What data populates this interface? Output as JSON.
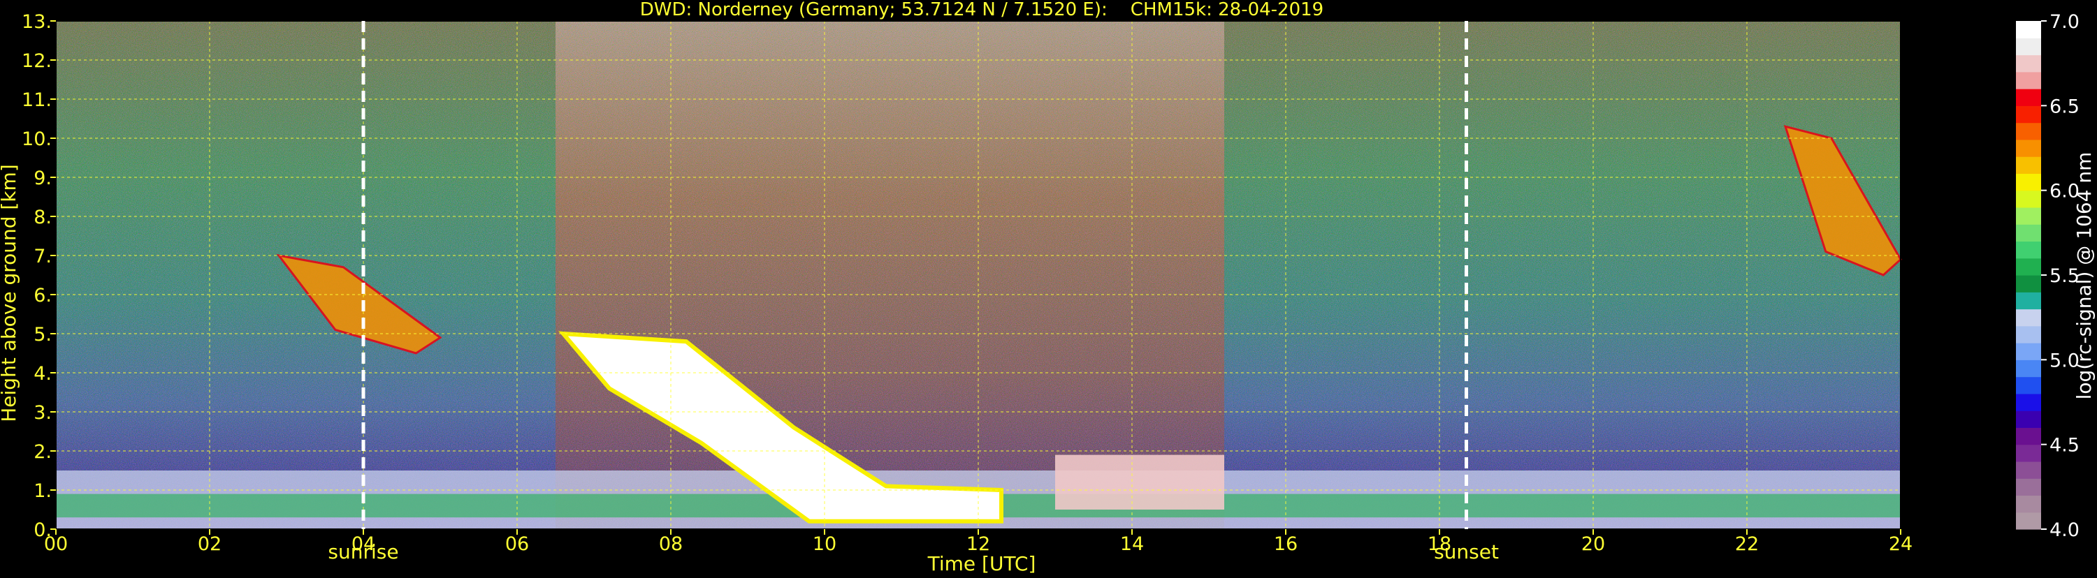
{
  "chart_data": {
    "type": "heatmap",
    "title": "DWD: Norderney (Germany; 53.7124 N / 7.1520 E):    CHM15k: 28-04-2019",
    "xlabel": "Time [UTC]",
    "ylabel": "Height above ground [km]",
    "xlim": [
      0,
      24
    ],
    "ylim": [
      0,
      13
    ],
    "x_ticks": [
      "00",
      "02",
      "04",
      "06",
      "08",
      "10",
      "12",
      "14",
      "16",
      "18",
      "20",
      "22",
      "24"
    ],
    "y_ticks": [
      "0.",
      "1.",
      "2.",
      "3.",
      "4.",
      "5.",
      "6.",
      "7.",
      "8.",
      "9.",
      "10.",
      "11.",
      "12.",
      "13."
    ],
    "grid": true,
    "markers": [
      {
        "name": "sunrise",
        "x": 4.0
      },
      {
        "name": "sunset",
        "x": 18.35
      }
    ],
    "colorbar": {
      "label": "log(rc-signal) @ 1064 nm",
      "range": [
        4.0,
        7.0
      ],
      "ticks": [
        "4.0",
        "4.5",
        "5.0",
        "5.5",
        "6.0",
        "6.5",
        "7.0"
      ],
      "colors": [
        "#b09aa6",
        "#a88aa0",
        "#9a6f9a",
        "#8c4f96",
        "#7a2a96",
        "#6a1090",
        "#3a00b0",
        "#1a10e8",
        "#2050f0",
        "#4a86f4",
        "#7aa6f6",
        "#a8c0f0",
        "#c8d2ee",
        "#20b0a0",
        "#109040",
        "#20b050",
        "#40d070",
        "#70e070",
        "#a0f060",
        "#d8f820",
        "#f8f000",
        "#f8c000",
        "#f89000",
        "#f86000",
        "#f82000",
        "#f00010",
        "#f0a0a0",
        "#f0c8c8",
        "#eeeeee",
        "#ffffff"
      ]
    },
    "features": [
      {
        "name": "boundary_layer_aerosol",
        "x": [
          0,
          24
        ],
        "y": [
          0,
          1.5
        ],
        "value": 5.3
      },
      {
        "name": "morning_cirrus",
        "x": [
          2.9,
          5.0
        ],
        "y": [
          4.5,
          7.0
        ],
        "value": 6.2
      },
      {
        "name": "descending_cloud",
        "x": [
          6.6,
          12.3
        ],
        "y": [
          0.2,
          5.0
        ],
        "value": 7.0
      },
      {
        "name": "low_clouds",
        "x": [
          13.0,
          15.2
        ],
        "y": [
          0.5,
          1.9
        ],
        "value": 6.8
      },
      {
        "name": "late_cirrus",
        "x": [
          22.5,
          24
        ],
        "y": [
          6.5,
          10.3
        ],
        "value": 6.2
      }
    ]
  }
}
